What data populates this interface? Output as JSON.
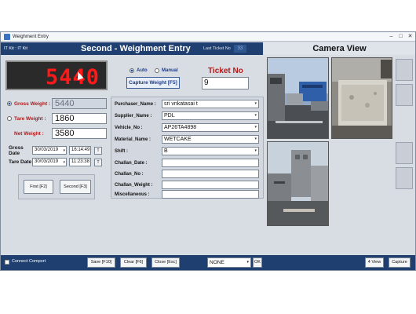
{
  "window": {
    "title": "Weighment Entry",
    "controls": [
      "–",
      "□",
      "✕"
    ]
  },
  "header": {
    "kit": "IT Kit : IT Kit",
    "title": "Second - Weighment Entry",
    "last_ticket_label": "Last Ticket No",
    "last_ticket_value": "33"
  },
  "camera": {
    "title": "Camera View"
  },
  "display": {
    "value": "5440"
  },
  "mode": {
    "auto_label": "Auto",
    "manual_label": "Manual",
    "selected": "Auto"
  },
  "ticket": {
    "label": "Ticket No",
    "value": "9",
    "capture_label": "Capture Weight [F5]"
  },
  "weights": {
    "gross_label": "Gross Weight :",
    "gross_value": "5440",
    "tare_label": "Tare Weight :",
    "tare_value": "1860",
    "net_label": "Net Weight :",
    "net_value": "3580",
    "selected": "gross"
  },
  "dates": {
    "gross_label": "Gross Date",
    "gross_date": "30/03/2019",
    "gross_time": "16:14:49",
    "tare_label": "Tare Date",
    "tare_date": "30/03/2019",
    "tare_time": "11:23:38",
    "t_label": "T"
  },
  "buttons": {
    "first": "First [F2]",
    "second": "Second [F3]"
  },
  "form": {
    "purchaser_label": "Purchaser_Name :",
    "purchaser_value": "sri vnkatasai t",
    "supplier_label": "Supplier_Name :",
    "supplier_value": "PDL",
    "vehicle_label": "Vehicle_No :",
    "vehicle_value": "AP26TA4898",
    "material_label": "Material_Name :",
    "material_value": "WETCAKE",
    "shift_label": "Shift :",
    "shift_value": "B",
    "challan_date_label": "Challan_Date :",
    "challan_date_value": "",
    "challan_no_label": "Challan_No :",
    "challan_no_value": "",
    "challan_weight_label": "Challan_Weight :",
    "challan_weight_value": "",
    "misc_label": "Miscellaneous :",
    "misc_value": ""
  },
  "bottom": {
    "connect_label": "Connect Comport",
    "save": "Save [F10]",
    "clear": "Clear [F6]",
    "close": "Close [Esc]",
    "select_value": "NONE",
    "ok": "OK",
    "view4": "4 View",
    "capture": "Capture"
  }
}
